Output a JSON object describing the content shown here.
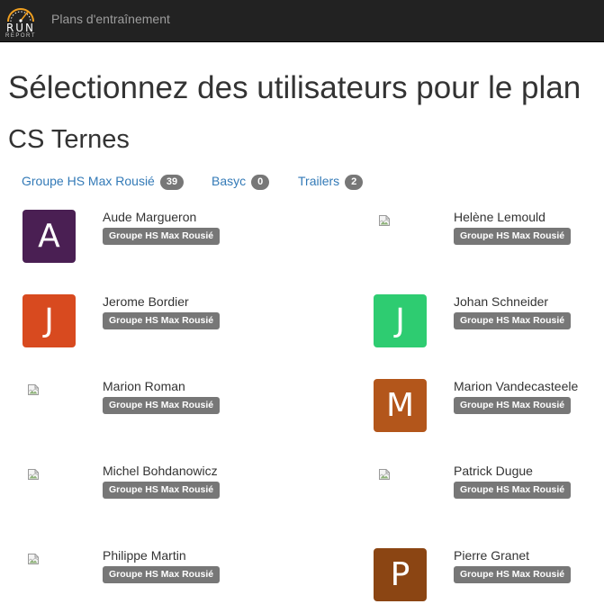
{
  "navbar": {
    "logo_word": "RUN",
    "logo_sub": "REPORT",
    "brand": "Plans d'entraînement"
  },
  "page": {
    "title": "Sélectionnez des utilisateurs pour le plan",
    "club": "CS Ternes"
  },
  "groups": [
    {
      "label": "Groupe HS Max Rousié",
      "count": "39"
    },
    {
      "label": "Basyc",
      "count": "0"
    },
    {
      "label": "Trailers",
      "count": "2"
    }
  ],
  "users": [
    {
      "name": "Aude Margueron",
      "group": "Groupe HS Max Rousié",
      "initial": "A",
      "color": "#4a1f53"
    },
    {
      "name": "Helène Lemould",
      "group": "Groupe HS Max Rousié",
      "initial": "",
      "color": ""
    },
    {
      "name": "Jerome Bordier",
      "group": "Groupe HS Max Rousié",
      "initial": "J",
      "color": "#d84a1f"
    },
    {
      "name": "Johan Schneider",
      "group": "Groupe HS Max Rousié",
      "initial": "J",
      "color": "#2ecc71"
    },
    {
      "name": "Marion Roman",
      "group": "Groupe HS Max Rousié",
      "initial": "",
      "color": ""
    },
    {
      "name": "Marion Vandecasteele",
      "group": "Groupe HS Max Rousié",
      "initial": "M",
      "color": "#b3561b"
    },
    {
      "name": "Michel Bohdanowicz",
      "group": "Groupe HS Max Rousié",
      "initial": "",
      "color": ""
    },
    {
      "name": "Patrick Dugue",
      "group": "Groupe HS Max Rousié",
      "initial": "",
      "color": ""
    },
    {
      "name": "Philippe Martin",
      "group": "Groupe HS Max Rousié",
      "initial": "",
      "color": ""
    },
    {
      "name": "Pierre Granet",
      "group": "Groupe HS Max Rousié",
      "initial": "P",
      "color": "#8b4513"
    }
  ]
}
